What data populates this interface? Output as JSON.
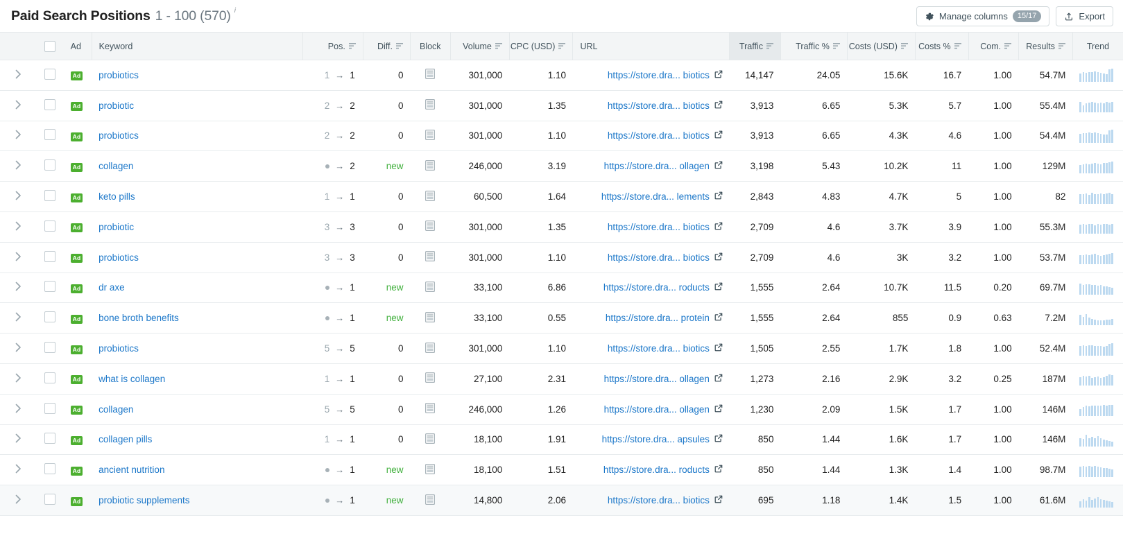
{
  "header": {
    "title": "Paid Search Positions",
    "range": "1 - 100 (570)",
    "info_marker": "i",
    "manage_columns_label": "Manage columns",
    "manage_columns_count": "15/17",
    "export_label": "Export",
    "gear_icon": "gear-icon",
    "export_icon": "upload-icon"
  },
  "table": {
    "columns": [
      {
        "key": "expander",
        "label": ""
      },
      {
        "key": "select",
        "label": ""
      },
      {
        "key": "ad",
        "label": "Ad",
        "align": "left",
        "sortable": false
      },
      {
        "key": "keyword",
        "label": "Keyword",
        "align": "left",
        "sortable": false
      },
      {
        "key": "pos",
        "label": "Pos.",
        "align": "right",
        "sortable": true
      },
      {
        "key": "diff",
        "label": "Diff.",
        "align": "right",
        "sortable": true
      },
      {
        "key": "block",
        "label": "Block",
        "align": "center",
        "sortable": false
      },
      {
        "key": "volume",
        "label": "Volume",
        "align": "right",
        "sortable": true
      },
      {
        "key": "cpc",
        "label": "CPC (USD)",
        "align": "right",
        "sortable": true
      },
      {
        "key": "url",
        "label": "URL",
        "align": "left",
        "sortable": false
      },
      {
        "key": "traffic",
        "label": "Traffic",
        "align": "right",
        "sortable": true,
        "sorted": true
      },
      {
        "key": "trafficp",
        "label": "Traffic %",
        "align": "right",
        "sortable": true
      },
      {
        "key": "costs",
        "label": "Costs (USD)",
        "align": "right",
        "sortable": true
      },
      {
        "key": "costsp",
        "label": "Costs %",
        "align": "right",
        "sortable": true
      },
      {
        "key": "com",
        "label": "Com.",
        "align": "right",
        "sortable": true
      },
      {
        "key": "results",
        "label": "Results",
        "align": "right",
        "sortable": true
      },
      {
        "key": "trend",
        "label": "Trend",
        "align": "center",
        "sortable": false
      }
    ],
    "select_all_checkbox": false,
    "ad_badge_label": "Ad",
    "url_prefix": "https://store.dra...",
    "rows": [
      {
        "ad": "Ad",
        "keyword": "probiotics",
        "pos_prev": "1",
        "pos_cur": "1",
        "diff": "0",
        "volume": "301,000",
        "cpc": "1.10",
        "url_tail": "biotics",
        "traffic": "14,147",
        "traffic_pct": "24.05",
        "costs": "15.6K",
        "costs_pct": "16.7",
        "com": "1.00",
        "results": "54.7M",
        "trend": [
          62,
          70,
          66,
          74,
          70,
          78,
          72,
          68,
          60,
          56,
          92,
          96
        ],
        "hovered": false
      },
      {
        "ad": "Ad",
        "keyword": "probiotic",
        "pos_prev": "2",
        "pos_cur": "2",
        "diff": "0",
        "volume": "301,000",
        "cpc": "1.35",
        "url_tail": "biotics",
        "traffic": "3,913",
        "traffic_pct": "6.65",
        "costs": "5.3K",
        "costs_pct": "5.7",
        "com": "1.00",
        "results": "55.4M",
        "trend": [
          74,
          52,
          68,
          72,
          76,
          70,
          66,
          72,
          68,
          74,
          70,
          76
        ],
        "hovered": false
      },
      {
        "ad": "Ad",
        "keyword": "probiotics",
        "pos_prev": "2",
        "pos_cur": "2",
        "diff": "0",
        "volume": "301,000",
        "cpc": "1.10",
        "url_tail": "biotics",
        "traffic": "3,913",
        "traffic_pct": "6.65",
        "costs": "4.3K",
        "costs_pct": "4.6",
        "com": "1.00",
        "results": "54.4M",
        "trend": [
          64,
          70,
          68,
          74,
          70,
          76,
          72,
          66,
          60,
          58,
          88,
          94
        ],
        "hovered": false
      },
      {
        "ad": "Ad",
        "keyword": "collagen",
        "pos_prev": null,
        "pos_cur": "2",
        "diff": "new",
        "volume": "246,000",
        "cpc": "3.19",
        "url_tail": "ollagen",
        "traffic": "3,198",
        "traffic_pct": "5.43",
        "costs": "10.2K",
        "costs_pct": "11",
        "com": "1.00",
        "results": "129M",
        "trend": [
          58,
          64,
          70,
          62,
          68,
          74,
          70,
          66,
          72,
          76,
          80,
          84
        ],
        "hovered": false
      },
      {
        "ad": "Ad",
        "keyword": "keto pills",
        "pos_prev": "1",
        "pos_cur": "1",
        "diff": "0",
        "volume": "60,500",
        "cpc": "1.64",
        "url_tail": "lements",
        "traffic": "2,843",
        "traffic_pct": "4.83",
        "costs": "4.7K",
        "costs_pct": "5",
        "com": "1.00",
        "results": "82",
        "trend": [
          70,
          66,
          72,
          64,
          78,
          70,
          68,
          74,
          66,
          72,
          78,
          70
        ],
        "hovered": false
      },
      {
        "ad": "Ad",
        "keyword": "probiotic",
        "pos_prev": "3",
        "pos_cur": "3",
        "diff": "0",
        "volume": "301,000",
        "cpc": "1.35",
        "url_tail": "biotics",
        "traffic": "2,709",
        "traffic_pct": "4.6",
        "costs": "3.7K",
        "costs_pct": "3.9",
        "com": "1.00",
        "results": "55.3M",
        "trend": [
          66,
          72,
          68,
          74,
          70,
          64,
          72,
          68,
          74,
          70,
          66,
          72
        ],
        "hovered": false
      },
      {
        "ad": "Ad",
        "keyword": "probiotics",
        "pos_prev": "3",
        "pos_cur": "3",
        "diff": "0",
        "volume": "301,000",
        "cpc": "1.10",
        "url_tail": "biotics",
        "traffic": "2,709",
        "traffic_pct": "4.6",
        "costs": "3K",
        "costs_pct": "3.2",
        "com": "1.00",
        "results": "53.7M",
        "trend": [
          68,
          64,
          72,
          66,
          70,
          74,
          68,
          62,
          66,
          72,
          78,
          82
        ],
        "hovered": false
      },
      {
        "ad": "Ad",
        "keyword": "dr axe",
        "pos_prev": null,
        "pos_cur": "1",
        "diff": "new",
        "volume": "33,100",
        "cpc": "6.86",
        "url_tail": "roducts",
        "traffic": "1,555",
        "traffic_pct": "2.64",
        "costs": "10.7K",
        "costs_pct": "11.5",
        "com": "0.20",
        "results": "69.7M",
        "trend": [
          78,
          70,
          74,
          76,
          68,
          72,
          66,
          70,
          62,
          58,
          54,
          50
        ],
        "hovered": false
      },
      {
        "ad": "Ad",
        "keyword": "bone broth benefits",
        "pos_prev": null,
        "pos_cur": "1",
        "diff": "new",
        "volume": "33,100",
        "cpc": "0.55",
        "url_tail": "protein",
        "traffic": "1,555",
        "traffic_pct": "2.64",
        "costs": "855",
        "costs_pct": "0.9",
        "com": "0.63",
        "results": "7.2M",
        "trend": [
          76,
          58,
          80,
          54,
          46,
          40,
          36,
          34,
          36,
          38,
          40,
          44
        ],
        "hovered": false
      },
      {
        "ad": "Ad",
        "keyword": "probiotics",
        "pos_prev": "5",
        "pos_cur": "5",
        "diff": "0",
        "volume": "301,000",
        "cpc": "1.10",
        "url_tail": "biotics",
        "traffic": "1,505",
        "traffic_pct": "2.55",
        "costs": "1.7K",
        "costs_pct": "1.8",
        "com": "1.00",
        "results": "52.4M",
        "trend": [
          70,
          72,
          70,
          74,
          72,
          70,
          68,
          66,
          64,
          70,
          82,
          86
        ],
        "hovered": false
      },
      {
        "ad": "Ad",
        "keyword": "what is collagen",
        "pos_prev": "1",
        "pos_cur": "1",
        "diff": "0",
        "volume": "27,100",
        "cpc": "2.31",
        "url_tail": "ollagen",
        "traffic": "1,273",
        "traffic_pct": "2.16",
        "costs": "2.9K",
        "costs_pct": "3.2",
        "com": "0.25",
        "results": "187M",
        "trend": [
          62,
          70,
          66,
          74,
          58,
          64,
          68,
          56,
          62,
          74,
          80,
          78
        ],
        "hovered": false
      },
      {
        "ad": "Ad",
        "keyword": "collagen",
        "pos_prev": "5",
        "pos_cur": "5",
        "diff": "0",
        "volume": "246,000",
        "cpc": "1.26",
        "url_tail": "ollagen",
        "traffic": "1,230",
        "traffic_pct": "2.09",
        "costs": "1.5K",
        "costs_pct": "1.7",
        "com": "1.00",
        "results": "146M",
        "trend": [
          52,
          66,
          74,
          72,
          76,
          74,
          78,
          76,
          80,
          78,
          82,
          80
        ],
        "hovered": false
      },
      {
        "ad": "Ad",
        "keyword": "collagen pills",
        "pos_prev": "1",
        "pos_cur": "1",
        "diff": "0",
        "volume": "18,100",
        "cpc": "1.91",
        "url_tail": "apsules",
        "traffic": "850",
        "traffic_pct": "1.44",
        "costs": "1.6K",
        "costs_pct": "1.7",
        "com": "1.00",
        "results": "146M",
        "trend": [
          60,
          54,
          86,
          62,
          70,
          58,
          74,
          60,
          52,
          46,
          40,
          36
        ],
        "hovered": false
      },
      {
        "ad": "Ad",
        "keyword": "ancient nutrition",
        "pos_prev": null,
        "pos_cur": "1",
        "diff": "new",
        "volume": "18,100",
        "cpc": "1.51",
        "url_tail": "roducts",
        "traffic": "850",
        "traffic_pct": "1.44",
        "costs": "1.3K",
        "costs_pct": "1.4",
        "com": "1.00",
        "results": "98.7M",
        "trend": [
          74,
          78,
          76,
          80,
          74,
          78,
          72,
          70,
          66,
          62,
          58,
          54
        ],
        "hovered": false
      },
      {
        "ad": "Ad",
        "keyword": "probiotic supplements",
        "pos_prev": null,
        "pos_cur": "1",
        "diff": "new",
        "volume": "14,800",
        "cpc": "2.06",
        "url_tail": "biotics",
        "traffic": "695",
        "traffic_pct": "1.18",
        "costs": "1.4K",
        "costs_pct": "1.5",
        "com": "1.00",
        "results": "61.6M",
        "trend": [
          44,
          58,
          48,
          72,
          52,
          64,
          74,
          60,
          54,
          48,
          44,
          40
        ],
        "hovered": true
      }
    ]
  },
  "colors": {
    "link": "#1b77c9",
    "ad_green": "#4caf2f",
    "new_green": "#41b03d",
    "header_bg": "#f3f5f6",
    "sorted_bg": "#e6eaec",
    "spark": "#bcd9f0"
  }
}
